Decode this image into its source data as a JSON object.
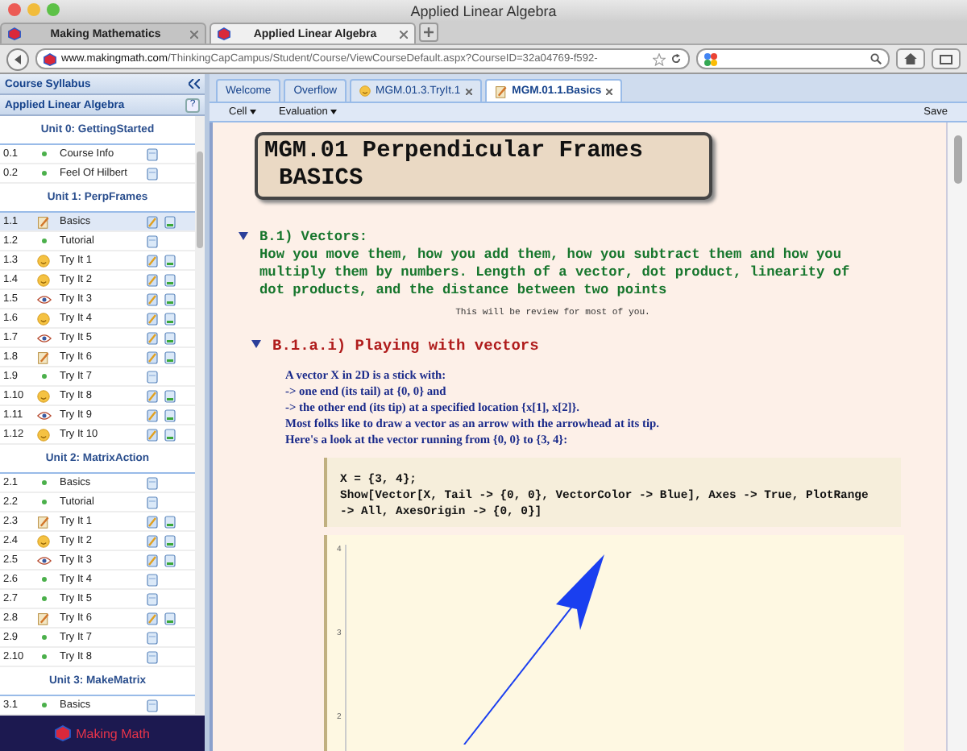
{
  "window": {
    "title": "Applied Linear Algebra"
  },
  "browser_tabs": [
    {
      "label": "Making Mathematics",
      "selected": false
    },
    {
      "label": "Applied Linear Algebra",
      "selected": true
    }
  ],
  "address_bar": {
    "domain": "www.makingmath.com",
    "path": "/ThinkingCapCampus/Student/Course/ViewCourseDefault.aspx?CourseID=32a04769-f592-"
  },
  "sidebar": {
    "title": "Course Syllabus",
    "course": "Applied Linear Algebra",
    "help": "?",
    "footer": "Making Math",
    "units": [
      {
        "title": "Unit 0: GettingStarted",
        "items": [
          {
            "number": "0.1",
            "label": "Course Info",
            "kind": "dot",
            "submitted": false,
            "selected": false
          },
          {
            "number": "0.2",
            "label": "Feel Of Hilbert",
            "kind": "dot",
            "submitted": false,
            "selected": false
          }
        ]
      },
      {
        "title": "Unit 1: PerpFrames",
        "items": [
          {
            "number": "1.1",
            "label": "Basics",
            "kind": "edit",
            "submitted": true,
            "selected": true
          },
          {
            "number": "1.2",
            "label": "Tutorial",
            "kind": "dot",
            "submitted": false,
            "selected": false
          },
          {
            "number": "1.3",
            "label": "Try It 1",
            "kind": "smiley",
            "submitted": true,
            "selected": false
          },
          {
            "number": "1.4",
            "label": "Try It 2",
            "kind": "smiley",
            "submitted": true,
            "selected": false
          },
          {
            "number": "1.5",
            "label": "Try It 3",
            "kind": "eye",
            "submitted": true,
            "selected": false
          },
          {
            "number": "1.6",
            "label": "Try It 4",
            "kind": "smiley",
            "submitted": true,
            "selected": false
          },
          {
            "number": "1.7",
            "label": "Try It 5",
            "kind": "eye",
            "submitted": true,
            "selected": false
          },
          {
            "number": "1.8",
            "label": "Try It 6",
            "kind": "edit",
            "submitted": true,
            "selected": false
          },
          {
            "number": "1.9",
            "label": "Try It 7",
            "kind": "dot",
            "submitted": false,
            "selected": false
          },
          {
            "number": "1.10",
            "label": "Try It 8",
            "kind": "smiley",
            "submitted": true,
            "selected": false
          },
          {
            "number": "1.11",
            "label": "Try It 9",
            "kind": "eye",
            "submitted": true,
            "selected": false
          },
          {
            "number": "1.12",
            "label": "Try It 10",
            "kind": "smiley",
            "submitted": true,
            "selected": false
          }
        ]
      },
      {
        "title": "Unit 2: MatrixAction",
        "items": [
          {
            "number": "2.1",
            "label": "Basics",
            "kind": "dot",
            "submitted": false,
            "selected": false
          },
          {
            "number": "2.2",
            "label": "Tutorial",
            "kind": "dot",
            "submitted": false,
            "selected": false
          },
          {
            "number": "2.3",
            "label": "Try It 1",
            "kind": "edit",
            "submitted": true,
            "selected": false
          },
          {
            "number": "2.4",
            "label": "Try It 2",
            "kind": "smiley",
            "submitted": true,
            "selected": false
          },
          {
            "number": "2.5",
            "label": "Try It 3",
            "kind": "eye",
            "submitted": true,
            "selected": false
          },
          {
            "number": "2.6",
            "label": "Try It 4",
            "kind": "dot",
            "submitted": false,
            "selected": false
          },
          {
            "number": "2.7",
            "label": "Try It 5",
            "kind": "dot",
            "submitted": false,
            "selected": false
          },
          {
            "number": "2.8",
            "label": "Try It 6",
            "kind": "edit",
            "submitted": true,
            "selected": false
          },
          {
            "number": "2.9",
            "label": "Try It 7",
            "kind": "dot",
            "submitted": false,
            "selected": false
          },
          {
            "number": "2.10",
            "label": "Try It 8",
            "kind": "dot",
            "submitted": false,
            "selected": false
          }
        ]
      },
      {
        "title": "Unit 3: MakeMatrix",
        "items": [
          {
            "number": "3.1",
            "label": "Basics",
            "kind": "dot",
            "submitted": false,
            "selected": false
          }
        ]
      }
    ]
  },
  "doc_tabs": [
    {
      "label": "Welcome",
      "kind": "plain",
      "closable": false,
      "selected": false
    },
    {
      "label": "Overflow",
      "kind": "plain",
      "closable": false,
      "selected": false
    },
    {
      "label": "MGM.01.3.TryIt.1",
      "kind": "smiley",
      "closable": true,
      "selected": false
    },
    {
      "label": "MGM.01.1.Basics",
      "kind": "edit",
      "closable": true,
      "selected": true
    }
  ],
  "toolbar": {
    "menus": [
      "Cell",
      "Evaluation"
    ],
    "save": "Save"
  },
  "notebook": {
    "title_lines": [
      "MGM.01 Perpendicular Frames",
      "BASICS"
    ],
    "section": {
      "heading": "B.1) Vectors:",
      "body": "How you move them, how you add them, how you subtract them and how you multiply them by numbers. Length of a vector, dot product, linearity of dot products, and the distance between two points",
      "expanded": true
    },
    "note": "This will be review for most of you.",
    "subsection": {
      "heading": "B.1.a.i) Playing with vectors",
      "expanded": true
    },
    "text_lines": [
      "A vector X in 2D is a stick with:",
      "-> one end (its tail) at {0, 0} and",
      "-> the other end (its tip) at a specified location {x[1], x[2]}.",
      "Most folks like to draw a vector as an arrow with the arrowhead at its tip.",
      "Here's a look at the vector running from {0, 0} to {3, 4}:"
    ],
    "input_lines": [
      "X = {3, 4};",
      "Show[Vector[X, Tail -> {0, 0}, VectorColor -> Blue], Axes -> True, PlotRange",
      "-> All, AxesOrigin -> {0, 0}]"
    ],
    "output_ticks": [
      "4",
      "3",
      "2"
    ]
  }
}
